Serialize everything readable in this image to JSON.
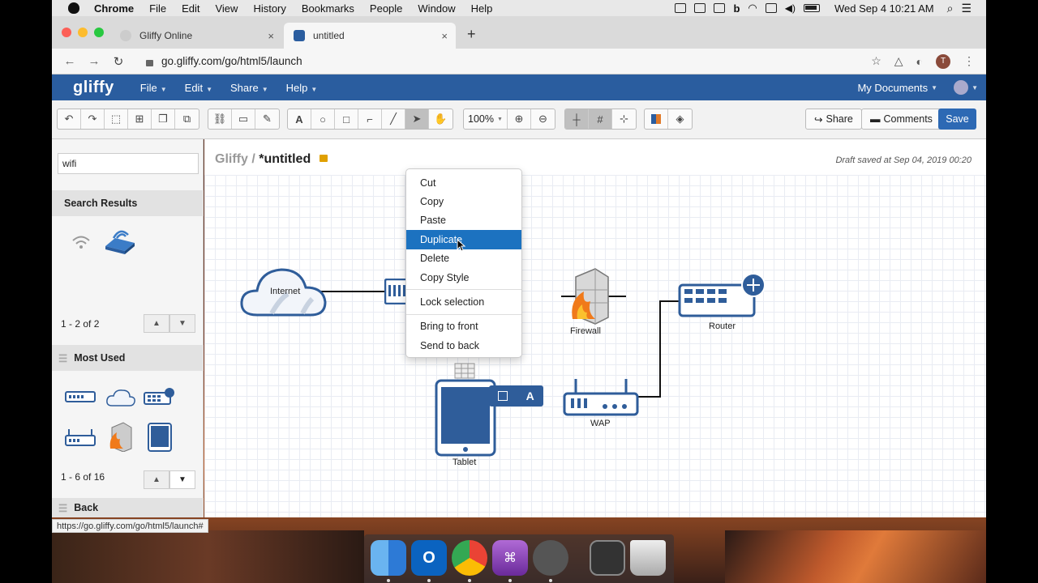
{
  "menubar": {
    "app": "Chrome",
    "items": [
      "File",
      "Edit",
      "View",
      "History",
      "Bookmarks",
      "People",
      "Window",
      "Help"
    ],
    "clock": "Wed Sep 4  10:21 AM"
  },
  "tabs": [
    {
      "title": "Gliffy Online",
      "close": "×"
    },
    {
      "title": "untitled",
      "close": "×"
    }
  ],
  "new_tab": "+",
  "address": {
    "url": "go.gliffy.com/go/html5/launch",
    "profile_initial": "T"
  },
  "app": {
    "logo": "gliffy",
    "menus": [
      "File",
      "Edit",
      "Share",
      "Help"
    ],
    "my_documents": "My Documents"
  },
  "toolbar": {
    "zoom": "100%",
    "share": "Share",
    "comments": "Comments",
    "save": "Save"
  },
  "sidebar": {
    "search_value": "wifi",
    "search_results_title": "Search Results",
    "search_pager": "1 - 2 of 2",
    "most_used_title": "Most Used",
    "most_used_pager": "1 - 6 of 16",
    "next_section_title": "Back"
  },
  "canvas": {
    "breadcrumb_root": "Gliffy /",
    "doc_title": "*untitled",
    "draft_status": "Draft saved at Sep 04, 2019 00:20",
    "nodes": {
      "internet": "Internet",
      "firewall": "Firewall",
      "router": "Router",
      "wap": "WAP",
      "tablet": "Tablet"
    }
  },
  "context_menu": {
    "group1": [
      "Cut",
      "Copy",
      "Paste",
      "Duplicate",
      "Delete",
      "Copy Style"
    ],
    "group2": [
      "Lock selection"
    ],
    "group3": [
      "Bring to front",
      "Send to back"
    ],
    "highlighted": "Duplicate"
  },
  "status_url": "https://go.gliffy.com/go/html5/launch#",
  "colors": {
    "app_blue": "#2a5d9f",
    "save_blue": "#2d69b4",
    "highlight": "#1c72c0",
    "shape_blue": "#2f5d9a"
  }
}
